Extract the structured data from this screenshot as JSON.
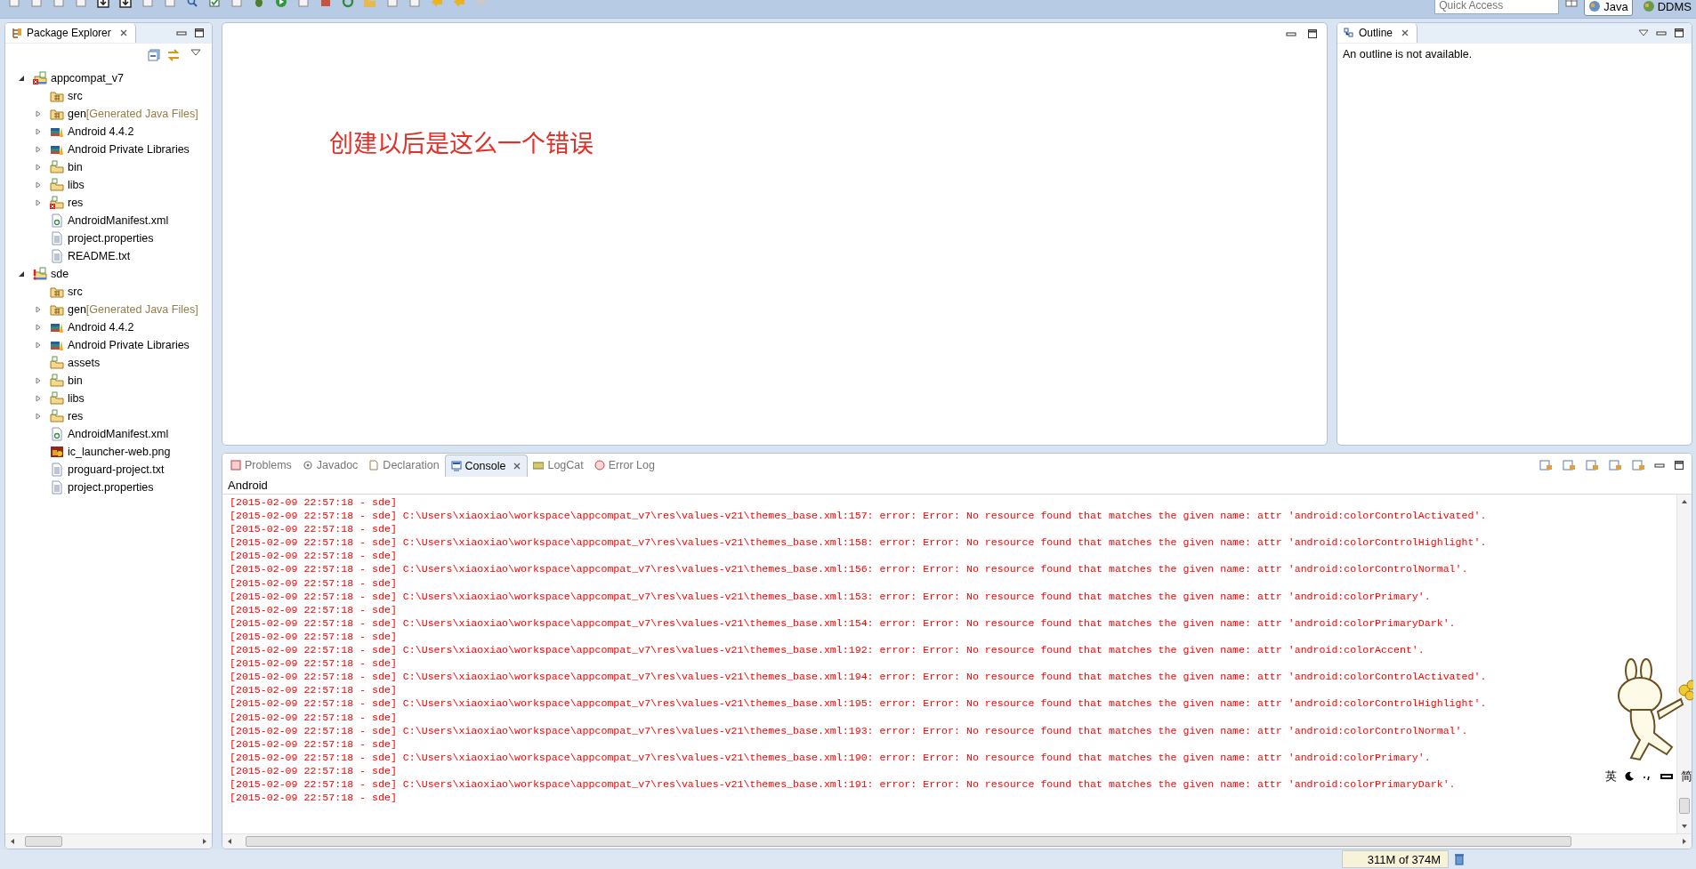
{
  "toolbar": {
    "quick_access": {
      "placeholder": "Quick Access"
    },
    "perspectives": [
      {
        "label": "Java",
        "selected": true
      },
      {
        "label": "DDMS",
        "selected": false
      }
    ]
  },
  "package_explorer": {
    "title": "Package Explorer",
    "tree": [
      {
        "label": "appcompat_v7",
        "kind": "project",
        "error": true,
        "build_path_error": false,
        "expanded": true,
        "children": [
          {
            "label": "src",
            "kind": "src-folder"
          },
          {
            "label": "gen",
            "decoration": "[Generated Java Files]",
            "kind": "src-folder",
            "expanded": false
          },
          {
            "label": "Android 4.4.2",
            "kind": "library",
            "expanded": false
          },
          {
            "label": "Android Private Libraries",
            "kind": "library",
            "expanded": false
          },
          {
            "label": "bin",
            "kind": "folder",
            "expanded": false
          },
          {
            "label": "libs",
            "kind": "folder",
            "expanded": false
          },
          {
            "label": "res",
            "kind": "folder",
            "error": true,
            "expanded": false
          },
          {
            "label": "AndroidManifest.xml",
            "kind": "manifest"
          },
          {
            "label": "project.properties",
            "kind": "file"
          },
          {
            "label": "README.txt",
            "kind": "file"
          }
        ]
      },
      {
        "label": "sde",
        "kind": "project",
        "error": false,
        "build_path_error": true,
        "expanded": true,
        "children": [
          {
            "label": "src",
            "kind": "src-folder"
          },
          {
            "label": "gen",
            "decoration": "[Generated Java Files]",
            "kind": "src-folder",
            "expanded": false
          },
          {
            "label": "Android 4.4.2",
            "kind": "library",
            "expanded": false
          },
          {
            "label": "Android Private Libraries",
            "kind": "library",
            "expanded": false
          },
          {
            "label": "assets",
            "kind": "folder"
          },
          {
            "label": "bin",
            "kind": "folder",
            "expanded": false
          },
          {
            "label": "libs",
            "kind": "folder",
            "expanded": false
          },
          {
            "label": "res",
            "kind": "folder",
            "expanded": false
          },
          {
            "label": "AndroidManifest.xml",
            "kind": "manifest"
          },
          {
            "label": "ic_launcher-web.png",
            "kind": "image"
          },
          {
            "label": "proguard-project.txt",
            "kind": "file"
          },
          {
            "label": "project.properties",
            "kind": "file"
          }
        ]
      }
    ]
  },
  "editor": {
    "note": "创建以后是这么一个错误"
  },
  "outline": {
    "title": "Outline",
    "message": "An outline is not available."
  },
  "console": {
    "tabs": [
      {
        "label": "Problems",
        "kind": "problems",
        "selected": false
      },
      {
        "label": "Javadoc",
        "kind": "javadoc",
        "selected": false
      },
      {
        "label": "Declaration",
        "kind": "declaration",
        "selected": false
      },
      {
        "label": "Console",
        "kind": "console",
        "selected": true
      },
      {
        "label": "LogCat",
        "kind": "logcat",
        "selected": false
      },
      {
        "label": "Error Log",
        "kind": "errorlog",
        "selected": false
      }
    ],
    "label": "Android",
    "lines": [
      "[2015-02-09 22:57:18 - sde]",
      "[2015-02-09 22:57:18 - sde] C:\\Users\\xiaoxiao\\workspace\\appcompat_v7\\res\\values-v21\\themes_base.xml:157: error: Error: No resource found that matches the given name: attr 'android:colorControlActivated'.",
      "[2015-02-09 22:57:18 - sde]",
      "[2015-02-09 22:57:18 - sde] C:\\Users\\xiaoxiao\\workspace\\appcompat_v7\\res\\values-v21\\themes_base.xml:158: error: Error: No resource found that matches the given name: attr 'android:colorControlHighlight'.",
      "[2015-02-09 22:57:18 - sde]",
      "[2015-02-09 22:57:18 - sde] C:\\Users\\xiaoxiao\\workspace\\appcompat_v7\\res\\values-v21\\themes_base.xml:156: error: Error: No resource found that matches the given name: attr 'android:colorControlNormal'.",
      "[2015-02-09 22:57:18 - sde]",
      "[2015-02-09 22:57:18 - sde] C:\\Users\\xiaoxiao\\workspace\\appcompat_v7\\res\\values-v21\\themes_base.xml:153: error: Error: No resource found that matches the given name: attr 'android:colorPrimary'.",
      "[2015-02-09 22:57:18 - sde]",
      "[2015-02-09 22:57:18 - sde] C:\\Users\\xiaoxiao\\workspace\\appcompat_v7\\res\\values-v21\\themes_base.xml:154: error: Error: No resource found that matches the given name: attr 'android:colorPrimaryDark'.",
      "[2015-02-09 22:57:18 - sde]",
      "[2015-02-09 22:57:18 - sde] C:\\Users\\xiaoxiao\\workspace\\appcompat_v7\\res\\values-v21\\themes_base.xml:192: error: Error: No resource found that matches the given name: attr 'android:colorAccent'.",
      "[2015-02-09 22:57:18 - sde]",
      "[2015-02-09 22:57:18 - sde] C:\\Users\\xiaoxiao\\workspace\\appcompat_v7\\res\\values-v21\\themes_base.xml:194: error: Error: No resource found that matches the given name: attr 'android:colorControlActivated'.",
      "[2015-02-09 22:57:18 - sde]",
      "[2015-02-09 22:57:18 - sde] C:\\Users\\xiaoxiao\\workspace\\appcompat_v7\\res\\values-v21\\themes_base.xml:195: error: Error: No resource found that matches the given name: attr 'android:colorControlHighlight'.",
      "[2015-02-09 22:57:18 - sde]",
      "[2015-02-09 22:57:18 - sde] C:\\Users\\xiaoxiao\\workspace\\appcompat_v7\\res\\values-v21\\themes_base.xml:193: error: Error: No resource found that matches the given name: attr 'android:colorControlNormal'.",
      "[2015-02-09 22:57:18 - sde]",
      "[2015-02-09 22:57:18 - sde] C:\\Users\\xiaoxiao\\workspace\\appcompat_v7\\res\\values-v21\\themes_base.xml:190: error: Error: No resource found that matches the given name: attr 'android:colorPrimary'.",
      "[2015-02-09 22:57:18 - sde]",
      "[2015-02-09 22:57:18 - sde] C:\\Users\\xiaoxiao\\workspace\\appcompat_v7\\res\\values-v21\\themes_base.xml:191: error: Error: No resource found that matches the given name: attr 'android:colorPrimaryDark'.",
      "[2015-02-09 22:57:18 - sde]"
    ]
  },
  "ime_bar": {
    "items": [
      "英",
      "简"
    ]
  },
  "status_bar": {
    "memory": "311M of 374M"
  }
}
